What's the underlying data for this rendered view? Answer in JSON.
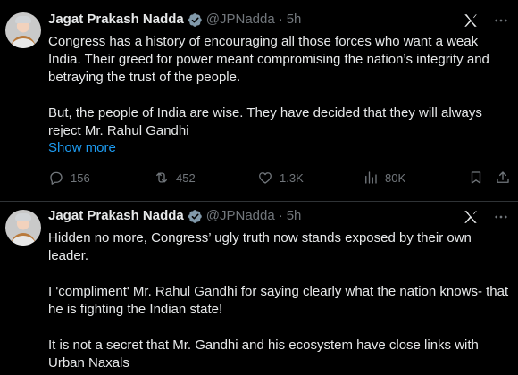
{
  "tweets": [
    {
      "author": "Jagat Prakash Nadda",
      "handle": "@JPNadda",
      "separator": "·",
      "time": "5h",
      "paragraphs": [
        "Congress has a history of encouraging all those forces who want a weak India. Their greed for power meant compromising the nation’s integrity and betraying the trust of the people.",
        "But, the people of India are wise. They have decided that they will always reject Mr. Rahul Gandhi"
      ],
      "show_more": "Show more",
      "replies": "156",
      "reposts": "452",
      "likes": "1.3K",
      "views": "80K"
    },
    {
      "author": "Jagat Prakash Nadda",
      "handle": "@JPNadda",
      "separator": "·",
      "time": "5h",
      "paragraphs": [
        "Hidden no more, Congress’ ugly truth now stands exposed by their own leader.",
        "I 'compliment' Mr. Rahul Gandhi for saying clearly what the nation knows- that he is fighting the Indian state!",
        "It is not a secret that Mr. Gandhi and his ecosystem have close links with Urban Naxals"
      ]
    }
  ],
  "colors": {
    "background": "#000000",
    "text": "#e7e9ea",
    "muted": "#71767b",
    "link": "#1d9bf0",
    "verified_badge": "#829aab"
  },
  "icons": [
    "grok-icon",
    "more-icon",
    "reply-icon",
    "repost-icon",
    "like-icon",
    "views-icon",
    "bookmark-icon",
    "share-icon",
    "verified-badge-icon"
  ]
}
